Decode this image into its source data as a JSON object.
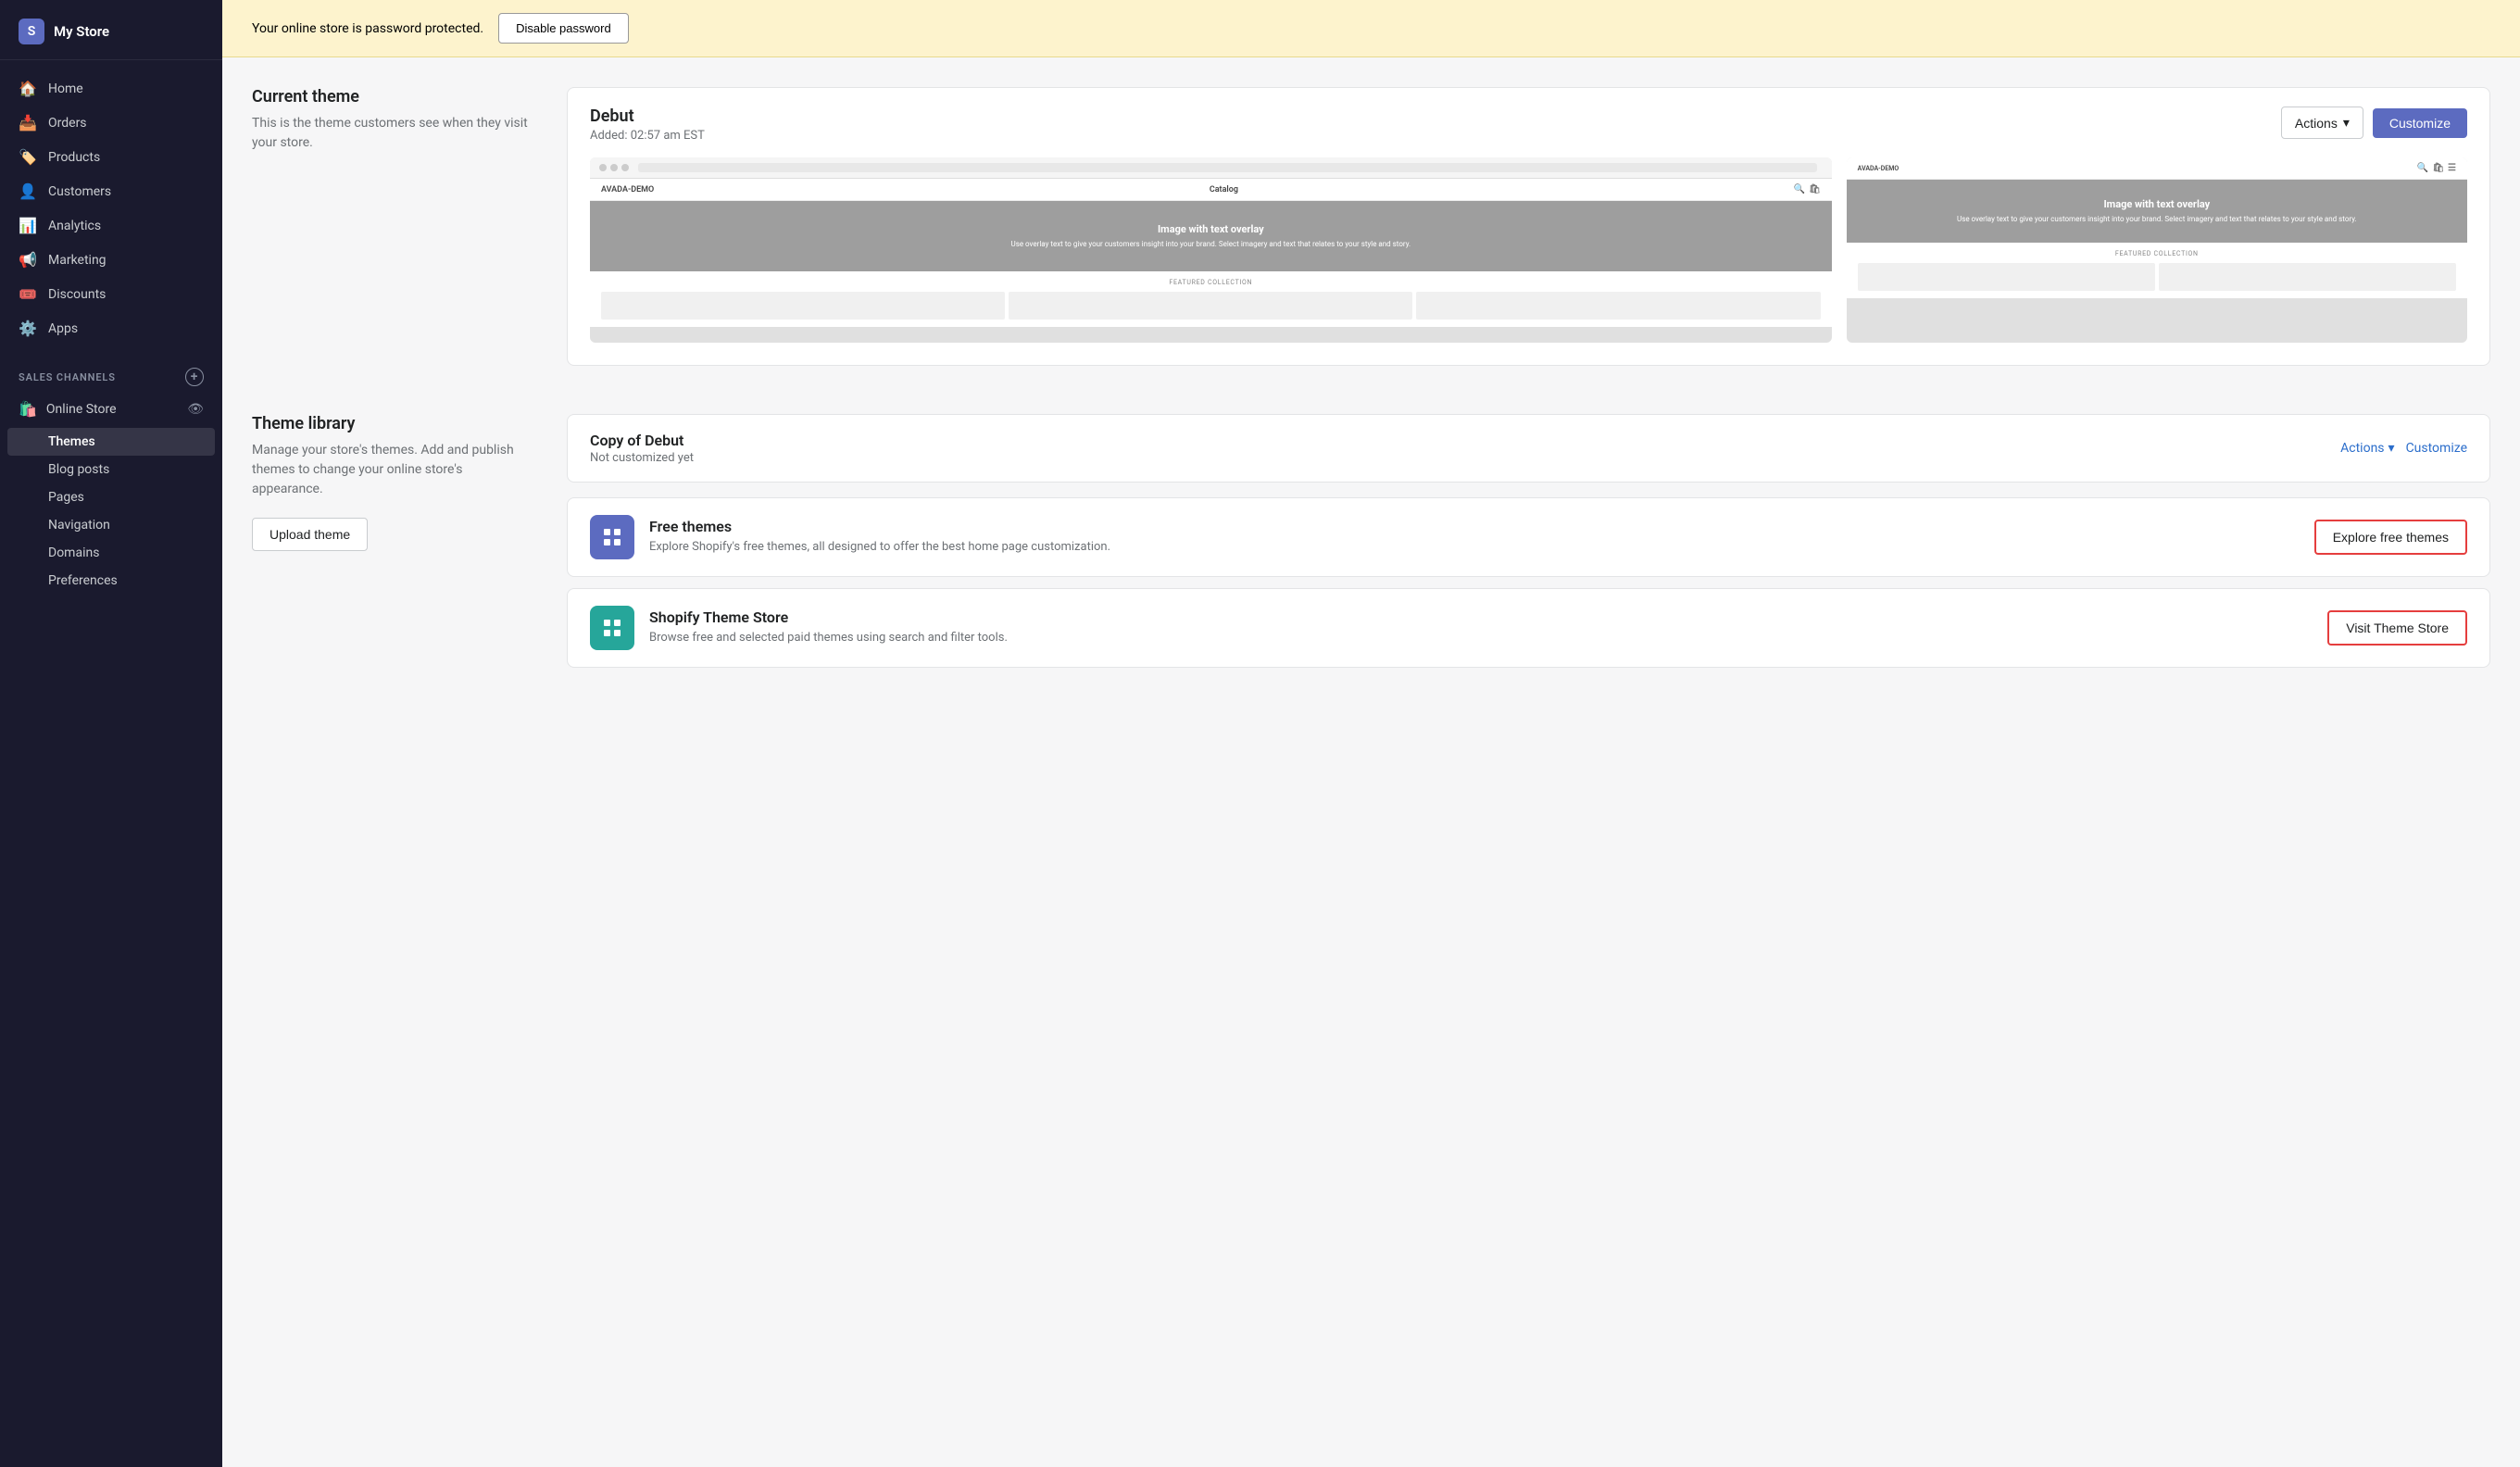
{
  "sidebar": {
    "store_name": "My Store",
    "nav_items": [
      {
        "id": "home",
        "label": "Home",
        "icon": "🏠"
      },
      {
        "id": "orders",
        "label": "Orders",
        "icon": "📥"
      },
      {
        "id": "products",
        "label": "Products",
        "icon": "🏷️"
      },
      {
        "id": "customers",
        "label": "Customers",
        "icon": "👤"
      },
      {
        "id": "analytics",
        "label": "Analytics",
        "icon": "📊"
      },
      {
        "id": "marketing",
        "label": "Marketing",
        "icon": "📢"
      },
      {
        "id": "discounts",
        "label": "Discounts",
        "icon": "🎟️"
      },
      {
        "id": "apps",
        "label": "Apps",
        "icon": "⚙️"
      }
    ],
    "sales_channels_label": "SALES CHANNELS",
    "online_store_label": "Online Store",
    "sub_items": [
      {
        "id": "themes",
        "label": "Themes",
        "active": true
      },
      {
        "id": "blog-posts",
        "label": "Blog posts",
        "active": false
      },
      {
        "id": "pages",
        "label": "Pages",
        "active": false
      },
      {
        "id": "navigation",
        "label": "Navigation",
        "active": false
      },
      {
        "id": "domains",
        "label": "Domains",
        "active": false
      },
      {
        "id": "preferences",
        "label": "Preferences",
        "active": false
      }
    ]
  },
  "top_bar": {
    "warning_text": "Your online store is password protected.",
    "disable_btn": "Disable password"
  },
  "current_theme": {
    "section_title": "Current theme",
    "section_desc": "This is the theme customers see when they visit your store.",
    "theme_name": "Debut",
    "theme_added": "Added: 02:57 am EST",
    "actions_btn": "Actions",
    "customize_btn": "Customize",
    "preview_site_name": "AVADA-DEMO",
    "preview_nav": "Catalog",
    "preview_hero_title": "Image with text overlay",
    "preview_hero_sub": "Use overlay text to give your customers insight into your brand. Select imagery and text that relates to your style and story.",
    "preview_featured_label": "FEATURED COLLECTION"
  },
  "theme_library": {
    "section_title": "Theme library",
    "section_desc": "Manage your store's themes. Add and publish themes to change your online store's appearance.",
    "upload_btn": "Upload theme",
    "copy_debut": {
      "name": "Copy of Debut",
      "status": "Not customized yet",
      "actions_label": "Actions",
      "customize_label": "Customize"
    },
    "free_themes": {
      "icon": "📋",
      "title": "Free themes",
      "desc": "Explore Shopify's free themes, all designed to offer the best home page customization.",
      "btn_label": "Explore free themes"
    },
    "shopify_store": {
      "icon": "📋",
      "title": "Shopify Theme Store",
      "desc": "Browse free and selected paid themes using search and filter tools.",
      "btn_label": "Visit Theme Store"
    }
  }
}
